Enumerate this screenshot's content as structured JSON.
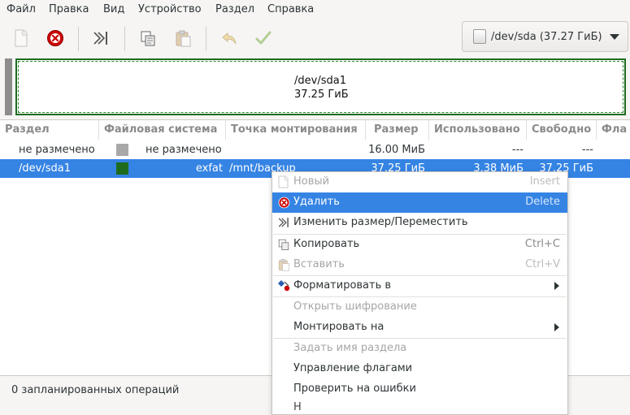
{
  "menubar": {
    "items": [
      "Файл",
      "Правка",
      "Вид",
      "Устройство",
      "Раздел",
      "Справка"
    ]
  },
  "toolbar": {
    "buttons": [
      "new-icon",
      "delete-icon",
      "resize-icon",
      "copy-icon",
      "paste-icon",
      "undo-icon",
      "apply-icon"
    ]
  },
  "device": {
    "label": "/dev/sda (37.27 ГиБ)"
  },
  "map": {
    "name": "/dev/sda1",
    "size": "37.25 ГиБ"
  },
  "table": {
    "headers": [
      "Раздел",
      "Файловая система",
      "Точка монтирования",
      "Размер",
      "Использовано",
      "Свободно",
      "Фла"
    ],
    "rows": [
      {
        "partition": "не размечено",
        "fs_color": "#a8a8a8",
        "fs": "не размечено",
        "mount": "",
        "size": "16.00 МиБ",
        "used": "---",
        "free": "---"
      },
      {
        "partition": "/dev/sda1",
        "fs_color": "#1e6b1e",
        "fs": "exfat",
        "mount": "/mnt/backup",
        "size": "37.25 ГиБ",
        "used": "3.38 МиБ",
        "free": "37.25 ГиБ"
      }
    ]
  },
  "context_menu": {
    "items": [
      {
        "label": "Новый",
        "accel": "Insert",
        "icon": "new-icon"
      },
      {
        "label": "Удалить",
        "accel": "Delete",
        "icon": "delete-icon"
      },
      {
        "label": "Изменить размер/Переместить",
        "accel": "",
        "icon": "resize-icon"
      },
      {
        "label": "Копировать",
        "accel": "Ctrl+C",
        "icon": "copy-icon"
      },
      {
        "label": "Вставить",
        "accel": "Ctrl+V",
        "icon": "paste-icon"
      },
      {
        "label": "Форматировать в",
        "accel": "",
        "icon": "format-icon"
      },
      {
        "label": "Открыть шифрование",
        "accel": "",
        "icon": ""
      },
      {
        "label": "Монтировать на",
        "accel": "",
        "icon": ""
      },
      {
        "label": "Задать имя раздела",
        "accel": "",
        "icon": ""
      },
      {
        "label": "Управление флагами",
        "accel": "",
        "icon": ""
      },
      {
        "label": "Проверить на ошибки",
        "accel": "",
        "icon": ""
      }
    ]
  },
  "status": {
    "text": "0 запланированных операций"
  },
  "colors": {
    "selection": "#3584e4",
    "exfat": "#1e6b1e",
    "unallocated": "#a8a8a8",
    "delete_red": "#cc0000"
  }
}
